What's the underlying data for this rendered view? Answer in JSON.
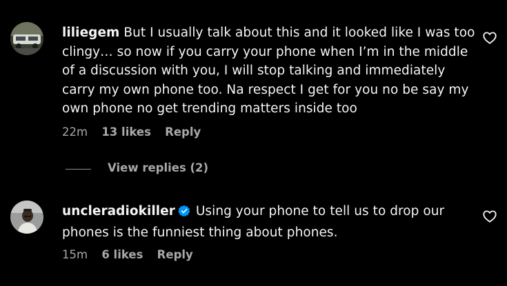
{
  "comments": [
    {
      "username": "liliegem",
      "verified": false,
      "text": "But I usually talk about this and it looked like I was too clingy… so now if you carry your phone when I’m in the middle of a discussion with you, I will stop talking and immediately carry my own phone too. Na respect I get for you no be say my own phone no get trending matters inside too",
      "time": "22m",
      "likes": "13 likes",
      "reply_label": "Reply",
      "view_replies": "View replies (2)"
    },
    {
      "username": "uncleradiokiller",
      "verified": true,
      "text": "Using your phone to tell us to drop our phones is the funniest thing about phones.",
      "time": "15m",
      "likes": "6 likes",
      "reply_label": "Reply"
    }
  ],
  "icons": {
    "like": "heart-outline-icon",
    "verified": "verified-badge-icon"
  },
  "colors": {
    "background": "#000000",
    "primary_text": "#f5f5f5",
    "secondary_text": "#a8a8a8",
    "verified_blue": "#0095f6"
  }
}
